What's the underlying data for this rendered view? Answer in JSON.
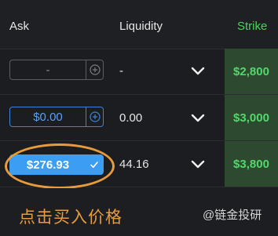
{
  "table": {
    "headers": {
      "ask": "Ask",
      "liquidity": "Liquidity",
      "strike": "Strike"
    },
    "rows": [
      {
        "ask_value": "-",
        "liquidity": "-",
        "strike": "$2,800",
        "ask_state": "empty"
      },
      {
        "ask_value": "$0.00",
        "liquidity": "0.00",
        "strike": "$3,000",
        "ask_state": "focused"
      },
      {
        "ask_value": "$276.93",
        "liquidity": "44.16",
        "strike": "$3,800",
        "ask_state": "confirmed"
      }
    ]
  },
  "annotation": {
    "caption": "点击买入价格",
    "watermark": "@链金投研"
  },
  "colors": {
    "strike_green": "#4dd25e",
    "focus_blue": "#3e82d6",
    "confirmed_blue": "#3b9ef3",
    "highlight_orange": "#e89b3d"
  },
  "icons": {
    "add": "plus-circle-icon",
    "confirm": "check-icon",
    "expand": "chevron-down-icon"
  }
}
